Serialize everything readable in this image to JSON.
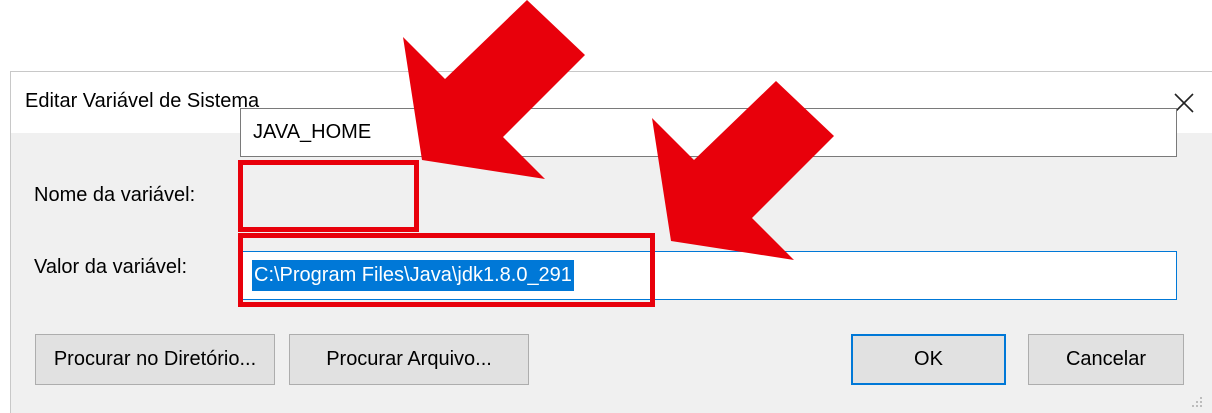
{
  "dialog": {
    "title": "Editar Variável de Sistema",
    "close_icon": "close-icon"
  },
  "fields": {
    "name_label": "Nome da variável:",
    "name_value": "JAVA_HOME",
    "value_label": "Valor da variável:",
    "value_value": "C:\\Program Files\\Java\\jdk1.8.0_291",
    "value_selected": true
  },
  "buttons": {
    "browse_directory": "Procurar no Diretório...",
    "browse_file": "Procurar Arquivo...",
    "ok": "OK",
    "cancel": "Cancelar"
  },
  "annotations": {
    "color": "#e8000b",
    "arrow_icon": "red-arrow-icon",
    "highlight_count": 2
  },
  "colors": {
    "accent": "#0078d7",
    "dialog_background": "#f0f0f0",
    "button_face": "#e1e1e1"
  }
}
